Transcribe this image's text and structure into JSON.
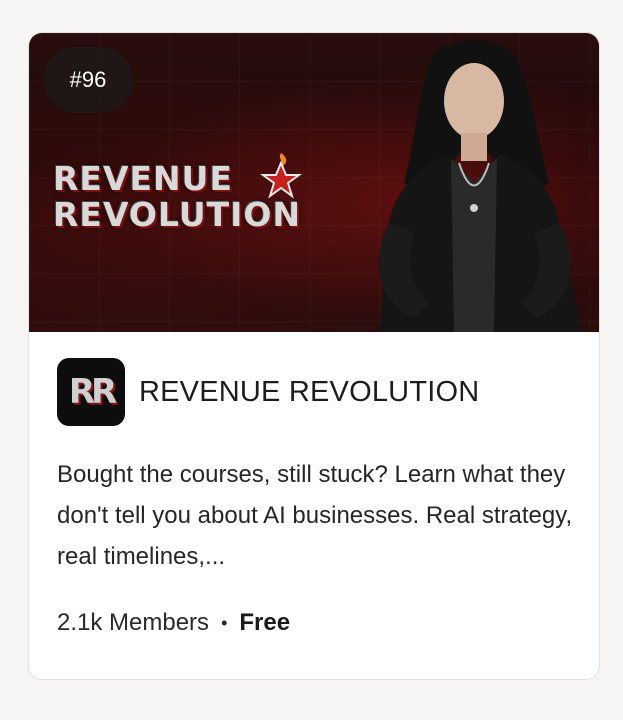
{
  "card": {
    "rank_badge": "#96",
    "banner_logo": {
      "line1": "REVENUE",
      "line2": "REVOLUTION"
    },
    "app_icon": {
      "monogram": "RR",
      "icon": "rr-monogram-icon"
    },
    "title": "REVENUE REVOLUTION",
    "description": "Bought the courses, still stuck? Learn what they don't tell you about AI businesses. Real strategy, real timelines,...",
    "members": "2.1k Members",
    "separator": "•",
    "price": "Free"
  },
  "colors": {
    "banner_dark": "#1a0707",
    "accent_red": "#c8201e",
    "card_bg": "#ffffff",
    "page_bg": "#f6f5f3"
  }
}
